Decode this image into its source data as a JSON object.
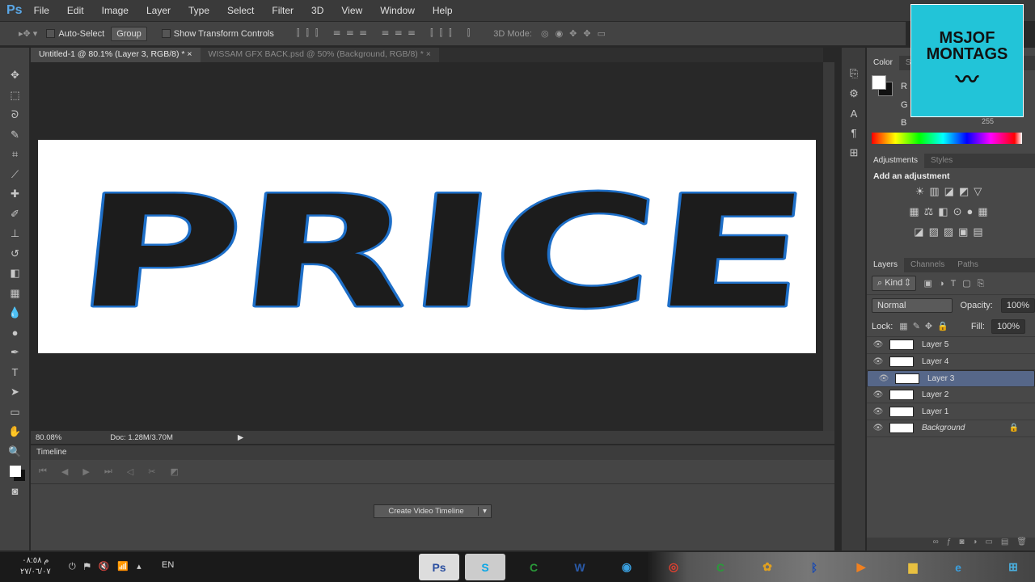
{
  "app": {
    "logo": "Ps"
  },
  "menu": [
    "File",
    "Edit",
    "Image",
    "Layer",
    "Type",
    "Select",
    "Filter",
    "3D",
    "View",
    "Window",
    "Help"
  ],
  "options": {
    "auto_select": "Auto-Select",
    "group": "Group",
    "show_transform": "Show Transform Controls",
    "mode_3d": "3D Mode:"
  },
  "tabs": [
    {
      "label": "Untitled-1 @ 80.1% (Layer 3, RGB/8) *",
      "close": "×"
    },
    {
      "label": "WISSAM GFX BACK.psd @ 50% (Background, RGB/8) *",
      "close": "×"
    }
  ],
  "canvas": {
    "text": "PRICE"
  },
  "status": {
    "zoom": "80.08%",
    "doc": "Doc: 1.28M/3.70M"
  },
  "timeline": {
    "title": "Timeline",
    "create_button": "Create Video Timeline"
  },
  "color_panel": {
    "tabs": [
      "Color",
      "Sw"
    ],
    "r": "R",
    "g": "G",
    "b": "B",
    "b_value": "255"
  },
  "badge": {
    "line1": "MSJOF",
    "line2": "MONTAGS"
  },
  "adjustments": {
    "tabs": [
      "Adjustments",
      "Styles"
    ],
    "heading": "Add an adjustment"
  },
  "layers_panel": {
    "tabs": [
      "Layers",
      "Channels",
      "Paths"
    ],
    "filter": "Kind",
    "blend": "Normal",
    "opacity_label": "Opacity:",
    "opacity": "100%",
    "lock_label": "Lock:",
    "fill_label": "Fill:",
    "fill": "100%",
    "layers": [
      {
        "name": "Layer 5"
      },
      {
        "name": "Layer 4"
      },
      {
        "name": "Layer 3",
        "selected": true
      },
      {
        "name": "Layer 2"
      },
      {
        "name": "Layer 1"
      },
      {
        "name": "Background",
        "locked": true
      }
    ]
  },
  "taskbar": {
    "time": "م ٠٨:٥٨",
    "date": "٢٧/٠٦/٠٧",
    "lang": "EN",
    "apps": [
      "Ps",
      "S"
    ]
  }
}
